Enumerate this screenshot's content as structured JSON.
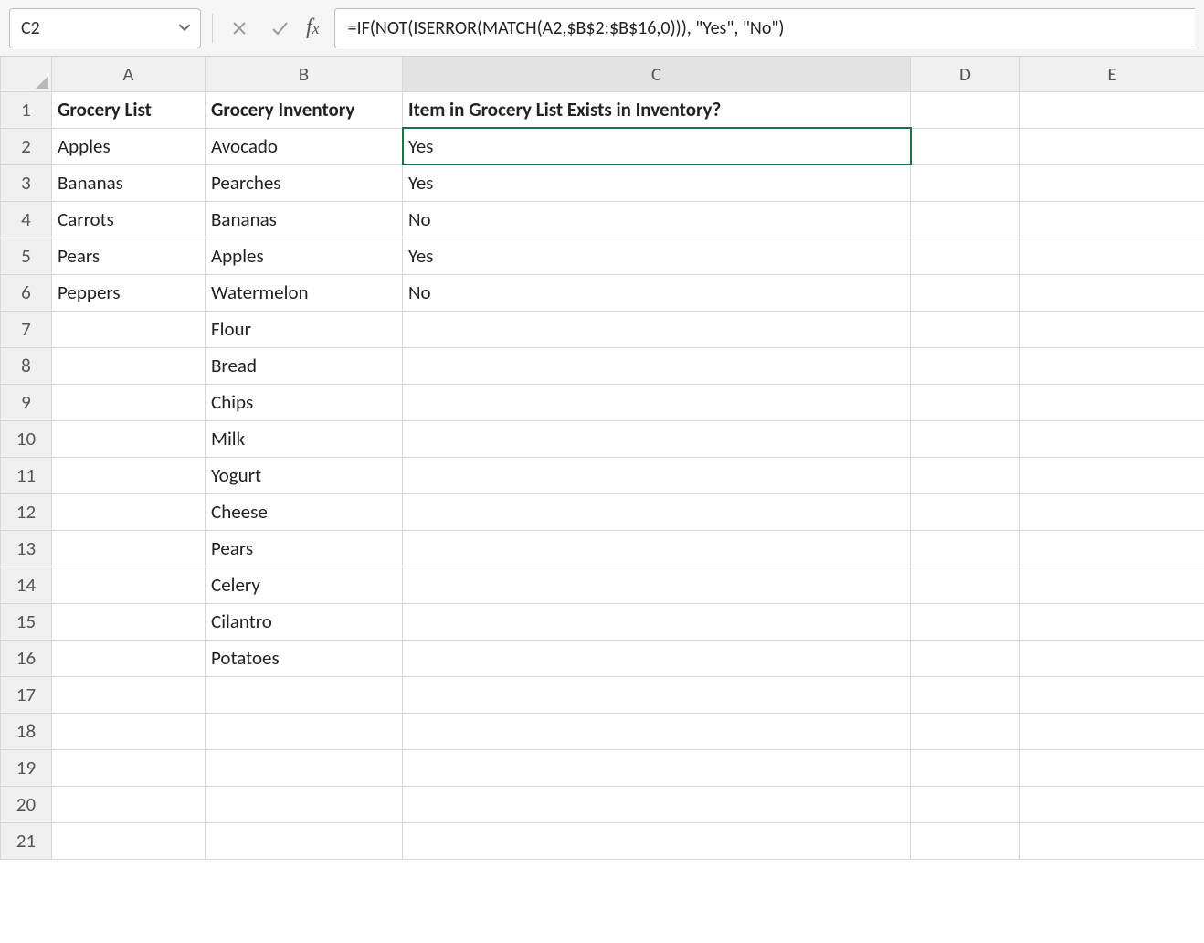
{
  "name_box": {
    "value": "C2"
  },
  "formula_bar": {
    "value": "=IF(NOT(ISERROR(MATCH(A2,$B$2:$B$16,0))), \"Yes\", \"No\")"
  },
  "columns": [
    "A",
    "B",
    "C",
    "D",
    "E"
  ],
  "row_count": 21,
  "active_cell": {
    "col": "C",
    "row": 2
  },
  "headers": {
    "A": "Grocery List",
    "B": "Grocery Inventory",
    "C": "Item in Grocery List Exists in Inventory?"
  },
  "data": {
    "A": [
      "Apples",
      "Bananas",
      "Carrots",
      "Pears",
      "Peppers"
    ],
    "B": [
      "Avocado",
      "Pearches",
      "Bananas",
      "Apples",
      "Watermelon",
      "Flour",
      "Bread",
      "Chips",
      "Milk",
      "Yogurt",
      "Cheese",
      "Pears",
      "Celery",
      "Cilantro",
      "Potatoes"
    ],
    "C": [
      "Yes",
      "Yes",
      "No",
      "Yes",
      "No"
    ]
  }
}
